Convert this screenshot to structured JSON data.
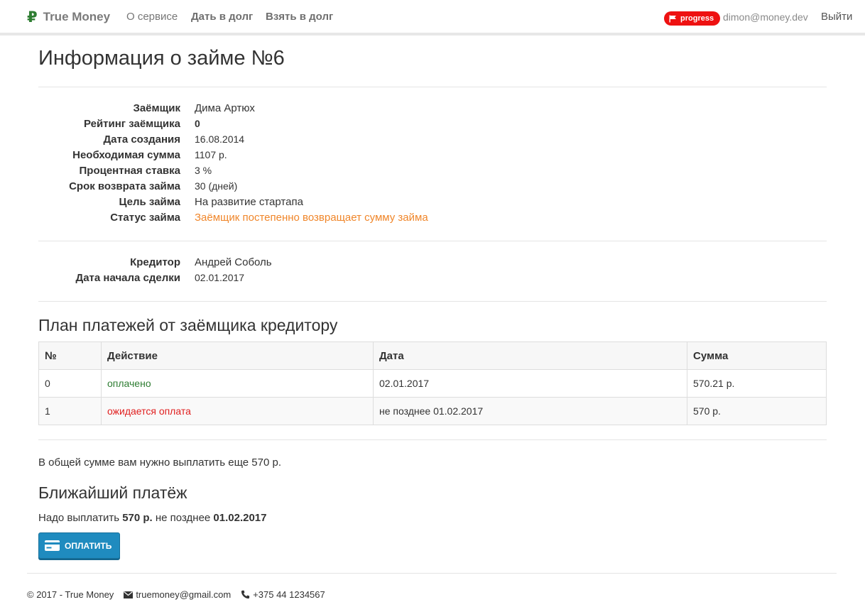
{
  "navbar": {
    "brand": "True Money",
    "brand_icon": "ruble-icon",
    "links": {
      "about": "О сервисе",
      "lend": "Дать в долг",
      "borrow": "Взять в долг"
    },
    "badge": "progress",
    "user_email": "dimon@money.dev",
    "logout": "Выйти"
  },
  "page": {
    "title": "Информация о займе №6"
  },
  "loan": {
    "borrower_label": "Заёмщик",
    "borrower": "Дима Артюх",
    "rating_label": "Рейтинг заёмщика",
    "rating": "0",
    "created_label": "Дата создания",
    "created": "16.08.2014",
    "amount_label": "Необходимая сумма",
    "amount": "1107 р.",
    "rate_label": "Процентная ставка",
    "rate": "3 %",
    "term_label": "Срок возврата займа",
    "term": "30 (дней)",
    "purpose_label": "Цель займа",
    "purpose": "На развитие стартапа",
    "status_label": "Статус займа",
    "status": "Заёмщик постепенно возвращает сумму займа"
  },
  "deal": {
    "creditor_label": "Кредитор",
    "creditor": "Андрей Соболь",
    "start_label": "Дата начала сделки",
    "start": "02.01.2017"
  },
  "plan": {
    "heading": "План платежей от заёмщика кредитору",
    "columns": [
      "№",
      "Действие",
      "Дата",
      "Сумма"
    ],
    "rows": [
      {
        "num": "0",
        "action": "оплачено",
        "date": "02.01.2017",
        "sum": "570.21 р."
      },
      {
        "num": "1",
        "action": "ожидается оплата",
        "date": "не позднее 01.02.2017",
        "sum": "570 р."
      }
    ]
  },
  "summary": {
    "total": "В общей сумме вам нужно выплатить еще 570 р."
  },
  "next_payment": {
    "heading": "Ближайший платёж",
    "prefix": "Надо выплатить",
    "amount": "570 р.",
    "middle": "не позднее",
    "date": "01.02.2017",
    "button": "ОПЛАТИТЬ"
  },
  "footer": {
    "copyright": "© 2017 - True Money",
    "email": "truemoney@gmail.com",
    "phone": "+375 44 1234567"
  },
  "colors": {
    "accent": "#1f8bbf",
    "badge": "#ee1111",
    "status_orange": "#f0862a",
    "paid_green": "#2e7d32",
    "pending_red": "#e02020"
  }
}
